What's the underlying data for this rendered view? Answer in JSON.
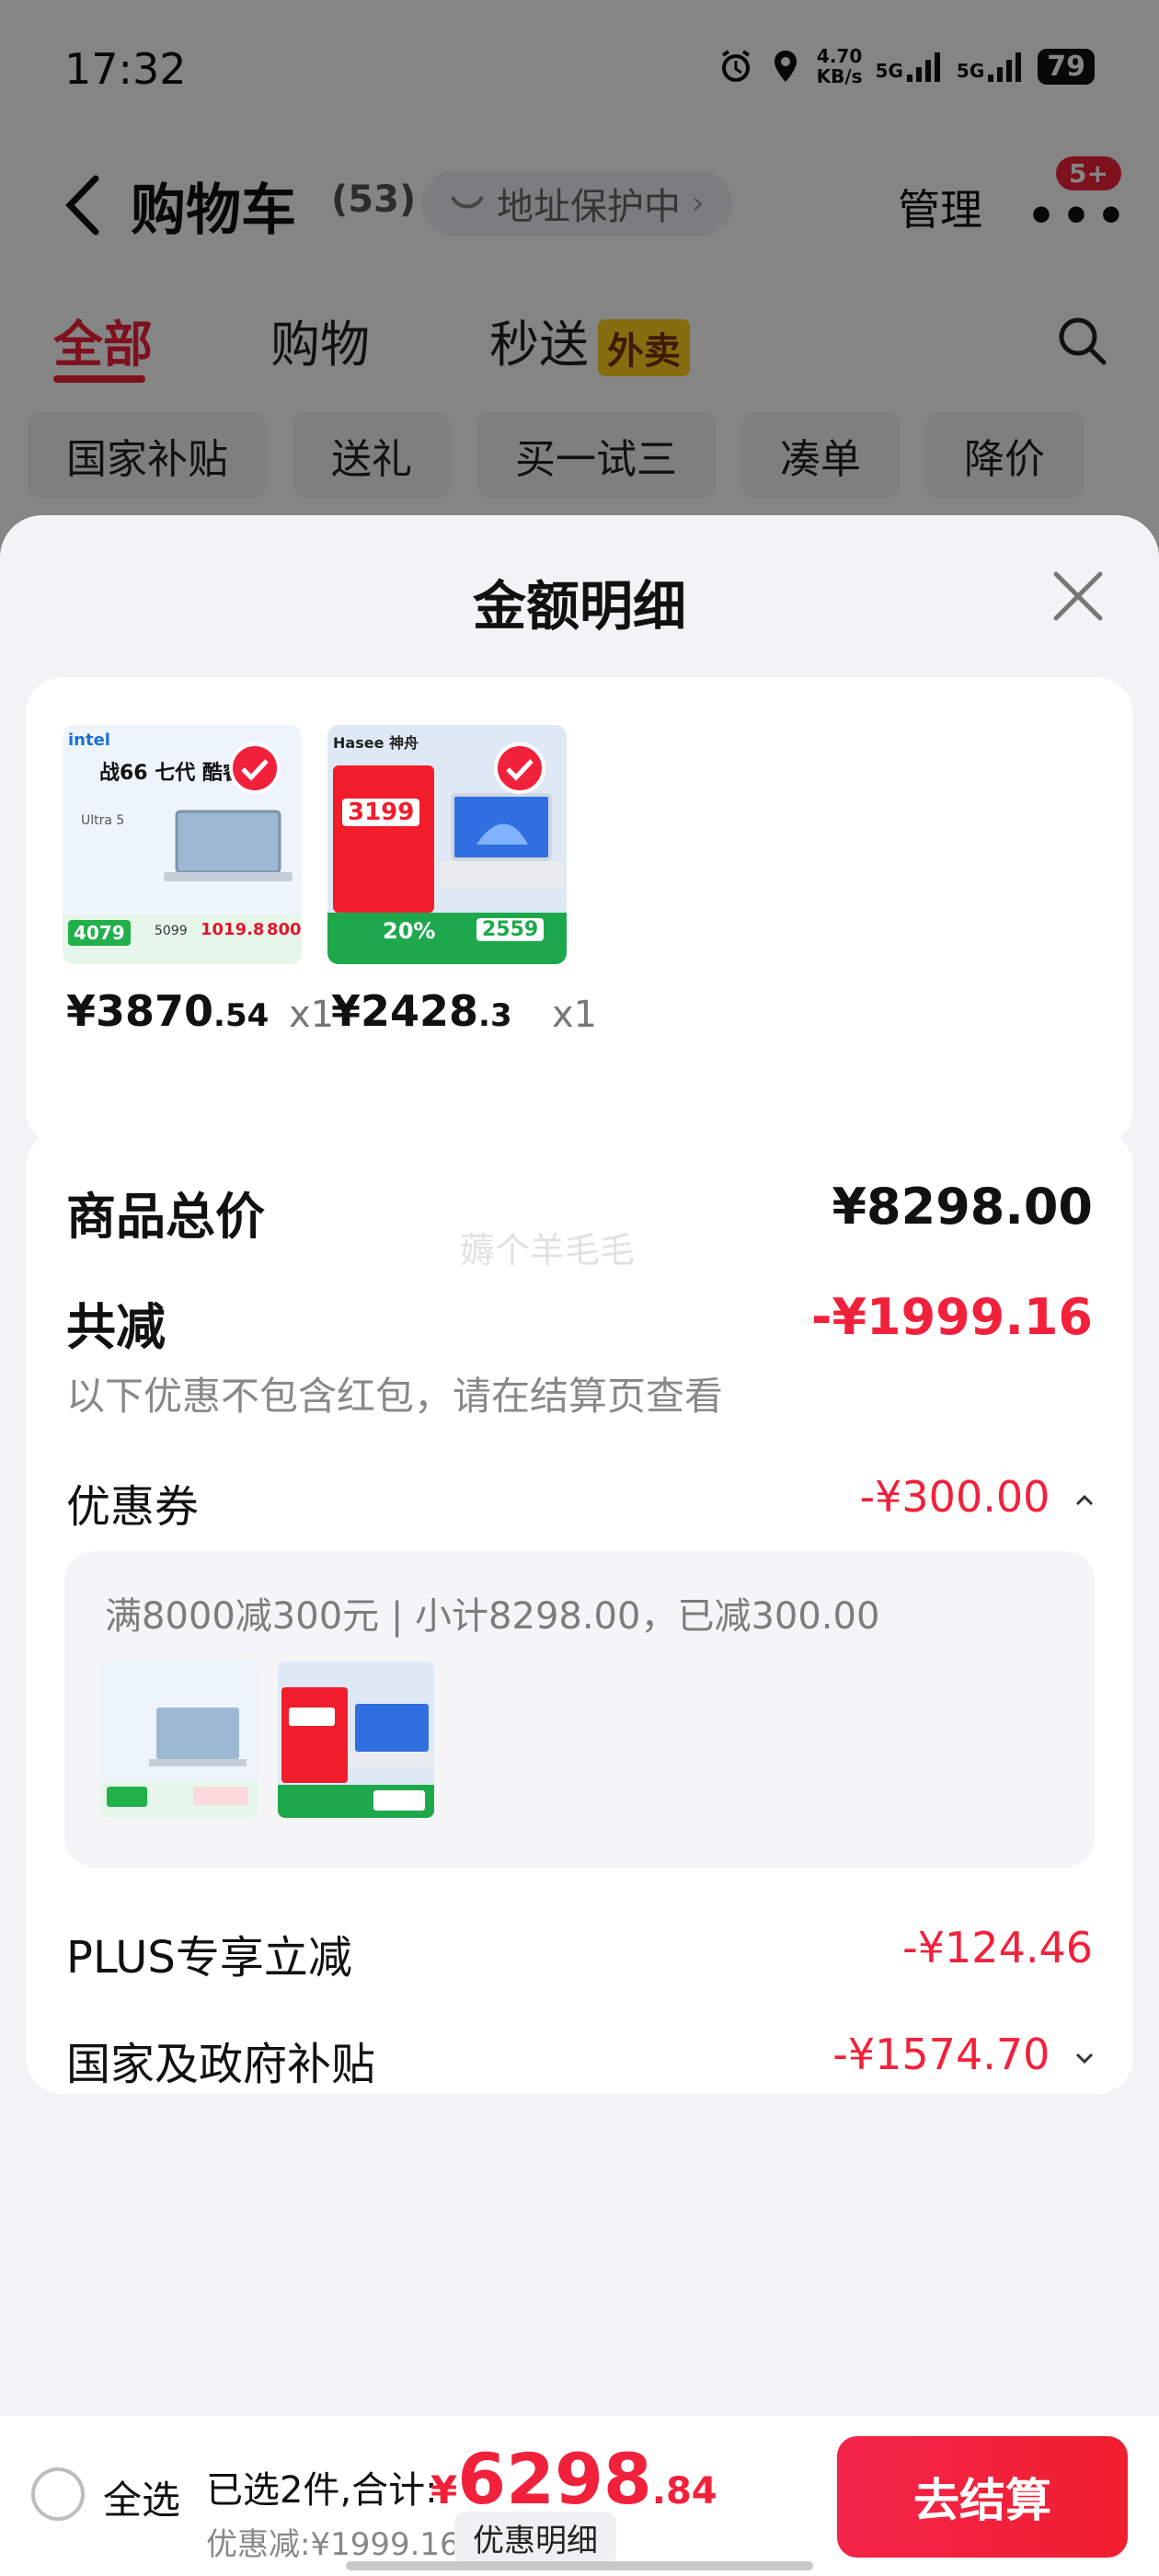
{
  "status_bar": {
    "time": "17:32",
    "speed_value": "4.70",
    "speed_unit": "KB/s",
    "net1": "5G",
    "net2": "5G",
    "battery": "79"
  },
  "nav": {
    "title": "购物车",
    "count": "(53)",
    "address_protect": "地址保护中",
    "manage": "管理",
    "more_badge": "5+"
  },
  "tabs": [
    {
      "label": "全部",
      "active": true
    },
    {
      "label": "购物",
      "active": false
    },
    {
      "label": "秒送",
      "badge": "外卖",
      "active": false
    }
  ],
  "chips": [
    "国家补贴",
    "送礼",
    "买一试三",
    "凑单",
    "降价"
  ],
  "sheet": {
    "title": "金额明细",
    "products": [
      {
        "price_int": "¥3870",
        "price_dec": ".54",
        "qty": "x1",
        "art": {
          "brand": "intel",
          "headline": "战66 七代 酷睿",
          "sub": "Ultra 5",
          "price1": "4079",
          "price2": "5099",
          "price3": "1019.8",
          "price4": "800"
        }
      },
      {
        "price_int": "¥2428",
        "price_dec": ".3",
        "qty": "x1",
        "art": {
          "brand": "Hasee 神舟",
          "price1": "3199",
          "tag": "20%",
          "price2": "2559"
        }
      }
    ],
    "summary": {
      "total_label": "商品总价",
      "total_value": "¥8298.00",
      "watermark": "薅个羊毛毛",
      "reduce_label": "共减",
      "reduce_value": "-¥1999.16",
      "reduce_note": "以下优惠不包含红包，请在结算页查看",
      "coupon_label": "优惠券",
      "coupon_value": "-¥300.00",
      "coupon_detail": "满8000减300元 | 小计8298.00，已减300.00",
      "plus_label": "PLUS专享立减",
      "plus_value": "-¥124.46",
      "gov_label": "国家及政府补贴",
      "gov_value": "-¥1574.70"
    }
  },
  "bottom_bar": {
    "select_all": "全选",
    "selected_text": "已选2件,合计:",
    "total_yen": "¥",
    "total_int": "6298",
    "total_dec": ".84",
    "discount_text": "优惠减:¥1999.16",
    "detail_button": "优惠明细",
    "checkout": "去结算"
  },
  "colors": {
    "accent": "#f2213b",
    "badge_yellow": "#ffd21e",
    "sheet_bg": "#f3f3f5"
  }
}
